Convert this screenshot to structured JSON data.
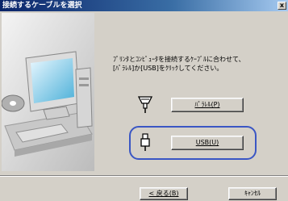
{
  "window": {
    "title": "接続するケーブルを選択",
    "close_glyph": "x"
  },
  "instruction": "ﾌﾟﾘﾝﾀとｺﾝﾋﾟｭｰﾀを接続するｹｰﾌﾞﾙに合わせて、\n[ﾊﾟﾗﾚﾙ]か[USB]をｸﾘｯｸしてください。",
  "buttons": {
    "parallel": "ﾊﾟﾗﾚﾙ(P)",
    "usb": "USB(U)",
    "back": "< 戻る(B)",
    "cancel": "ｷｬﾝｾﾙ"
  },
  "icons": {
    "parallel": "parallel-connector-icon",
    "usb": "usb-connector-icon",
    "computer": "computer-illustration"
  },
  "colors": {
    "title_start": "#0a246a",
    "title_end": "#a6caf0",
    "usb_highlight": "#3a56c4",
    "dialog_bg": "#d4d0c8"
  }
}
